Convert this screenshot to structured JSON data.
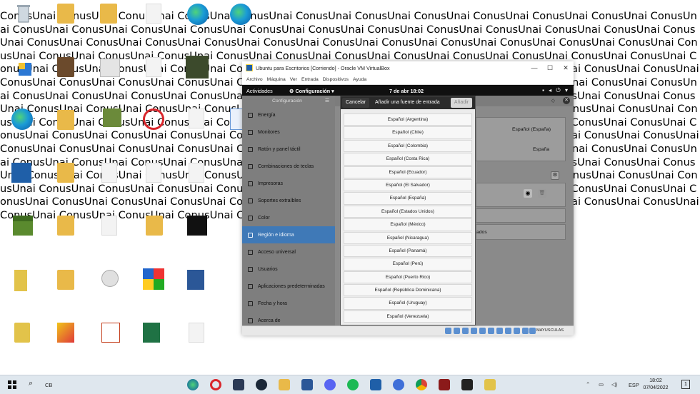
{
  "desktop": {
    "repeated_text": "ConusUnai ConusUnai ConusUnai ConusUnai ConusUnai ConusUnai ConusUnai ConusUnai ConusUnai ConusUnai ConusUnai ConusUnai ConusUnai ConusUnai ConusUnai ConusUnai ConusUnai ConusUnai ConusUnai ConusUnai ConusUnai ConusUnai ConusUnai ConusUnai ConusUnai ConusUnai ConusUnai ConusUnai ConusUnai ConusUnai ConusUnai ConusUnai ConusUnai ConusUnai ConusUnai ConusUnai ConusUnai ConusUnai ConusUnai ConusUnai ConusUnai ConusUnai ConusUnai ConusUnai ConusUnai ConusUnai ConusUnai ConusUnai ConusUnai ConusUnai ConusUnai ConusUnai ConusUnai ConusUnai ConusUnai ConusUnai ConusUnai ConusUnai ConusUnai ConusUnai ConusUnai ConusUnai ConusUnai ConusUnai ConusUnai ConusUnai ConusUnai ConusUnai ConusUnai ConusUnai ConusUnai ConusUnai ConusUnai ConusUnai ConusUnai ConusUnai ConusUnai ConusUnai ConusUnai ConusUnai ConusUnai ConusUnai ConusUnai ConusUnai ConusUnai ConusUnai ConusUnai ConusUnai ConusUnai ConusUnai ConusUnai ConusUnai ConusUnai ConusUnai ConusUnai ConusUnai ConusUnai ConusUnai ConusUnai ConusUnai ConusUnai ConusUnai ConusUnai ConusUnai ConusUnai ConusUnai ConusUnai ConusUnai ConusUnai ConusUnai ConusUnai ConusUnai ConusUnai ConusUnai ConusUnai ConusUnai ConusUnai ConusUnai ConusUnai ConusUnai ConusUnai ConusUnai ConusUnai ConusUnai ConusUnai ConusUnai ConusUnai ConusUnai ConusUnai ConusUnai ConusUnai ConusUnai ConusUnai ConusUnai ConusUnai ConusUnai ConusUnai ConusUnai ConusUnai ConusUnai ConusUnai ConusUnai ConusUnai ConusUnai ConusUnai ConusUnai ConusUnai ConusUnai ConusUnai ConusUnai ConusUnai ConusUnai ConusUnai ConusUnai ConusUnai ConusUnai ConusUnai ConusUnai ConusUnai ConusUnai ConusUnai ConusUnai ConusUnai ConusUnai ConusUnai ConusUnai ConusUnai ConusUnai ConusUnai ConusUnai ConusUnai ConusUnai ConusUnai ConusUnai ConusUnai ConusUnai ConusUnai ConusUnai ConusUnai ConusUnai ConusUnai ConusUnai ConusUnai ConusUnai ConusUnai ConusUnai Conus"
  },
  "vbox": {
    "title": "Ubuntu para Escritorios [Corriendo] - Oracle VM VirtualBox",
    "menu": [
      "Archivo",
      "Máquina",
      "Ver",
      "Entrada",
      "Dispositivos",
      "Ayuda"
    ],
    "status_caps": "MAYUSCULAS"
  },
  "ubuntu": {
    "activities": "Actividades",
    "app_menu": "⚙ Configuración ▾",
    "clock": "7 de abr  18:02",
    "sidebar_title": "Configuración",
    "sidebar_items": [
      "Energía",
      "Monitores",
      "Ratón y panel táctil",
      "Combinaciones de teclas",
      "Impresoras",
      "Soportes extraíbles",
      "Color",
      "Región e idioma",
      "Acceso universal",
      "Usuarios",
      "Aplicaciones predeterminadas",
      "Fecha y hora",
      "Acerca de"
    ],
    "right_values": [
      "Español (España)",
      "España",
      "ados"
    ]
  },
  "dialog": {
    "cancel": "Cancelar",
    "title": "Añadir una fuente de entrada",
    "add": "Añadir",
    "items": [
      "Español (Argentina)",
      "Español (Chile)",
      "Español (Colombia)",
      "Español (Costa Rica)",
      "Español (Ecuador)",
      "Español (El Salvador)",
      "Español (España)",
      "Español (Estados Unidos)",
      "Español (México)",
      "Español (Nicaragua)",
      "Español (Panamá)",
      "Español (Perú)",
      "Español (Puerto Rico)",
      "Español (República Dominicana)",
      "Español (Uruguay)",
      "Español (Venezuela)"
    ]
  },
  "taskbar": {
    "search_hint": "CB",
    "lang": "ESP",
    "time": "18:02",
    "date": "07/04/2022"
  }
}
